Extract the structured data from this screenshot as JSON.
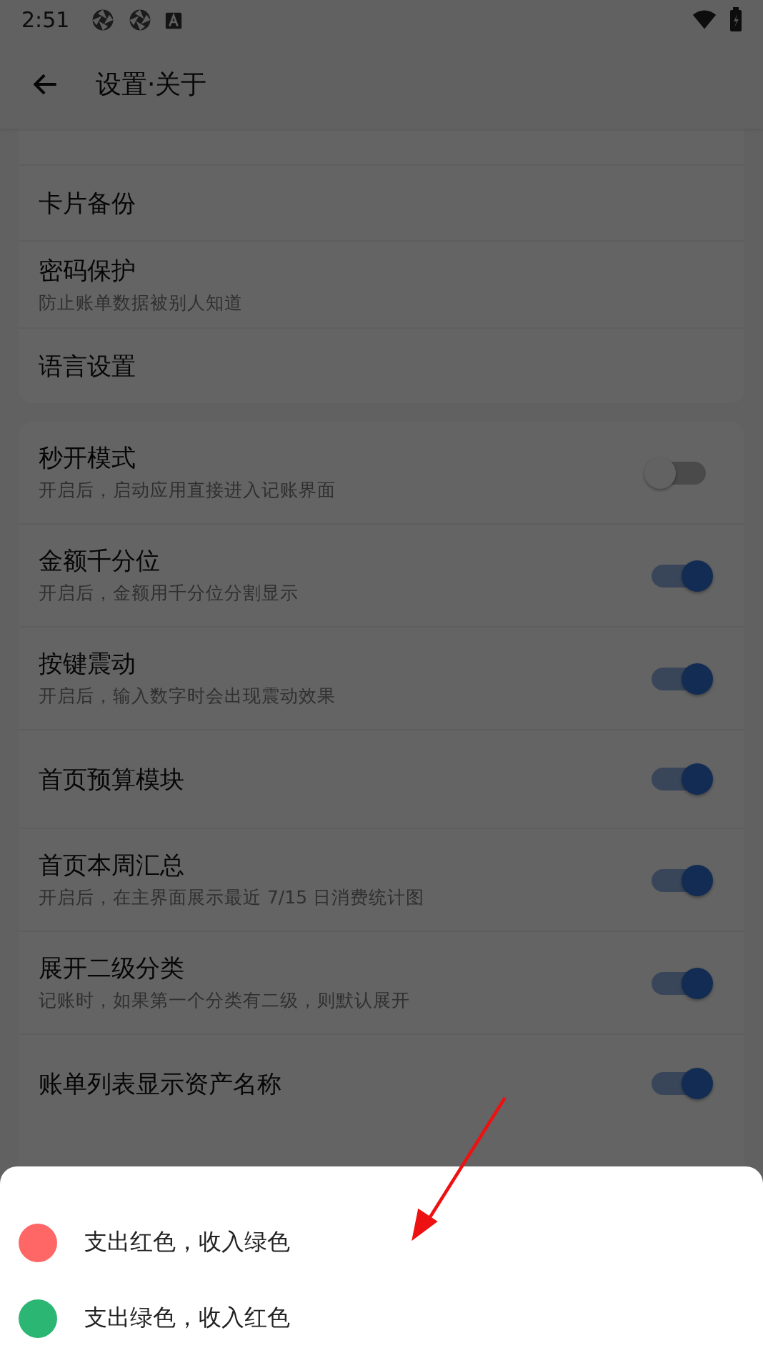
{
  "status_bar": {
    "time": "2:51"
  },
  "app_bar": {
    "title": "设置·关于"
  },
  "sections": [
    {
      "items": [
        {
          "kind": "link",
          "title": "卡片备份"
        },
        {
          "kind": "link",
          "title": "密码保护",
          "subtitle": "防止账单数据被别人知道"
        },
        {
          "kind": "link",
          "title": "语言设置"
        }
      ]
    },
    {
      "items": [
        {
          "kind": "toggle",
          "title": "秒开模式",
          "subtitle": "开启后，启动应用直接进入记账界面",
          "on": false
        },
        {
          "kind": "toggle",
          "title": "金额千分位",
          "subtitle": "开启后，金额用千分位分割显示",
          "on": true
        },
        {
          "kind": "toggle",
          "title": "按键震动",
          "subtitle": "开启后，输入数字时会出现震动效果",
          "on": true
        },
        {
          "kind": "toggle",
          "title": "首页预算模块",
          "on": true
        },
        {
          "kind": "toggle",
          "title": "首页本周汇总",
          "subtitle": "开启后，在主界面展示最近 7/15 日消费统计图",
          "on": true
        },
        {
          "kind": "toggle",
          "title": "展开二级分类",
          "subtitle": "记账时，如果第一个分类有二级，则默认展开",
          "on": true
        },
        {
          "kind": "toggle",
          "title": "账单列表显示资产名称",
          "on": true
        }
      ]
    }
  ],
  "sheet": {
    "options": [
      {
        "label": "支出红色，收入绿色",
        "color": "#ff6666"
      },
      {
        "label": "支出绿色，收入红色",
        "color": "#2bb673"
      }
    ]
  }
}
